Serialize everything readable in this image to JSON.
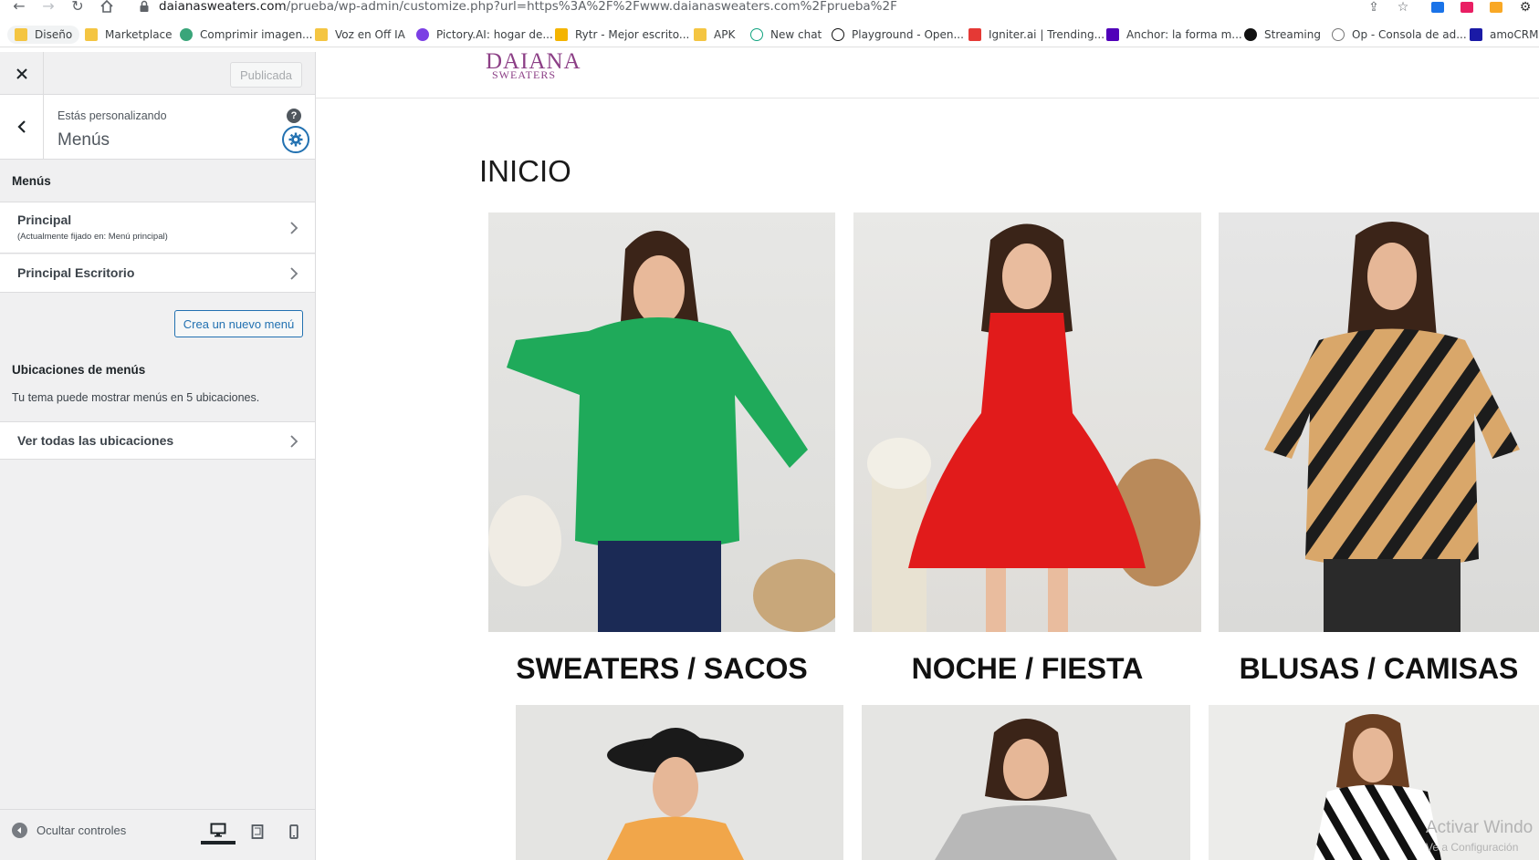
{
  "browser": {
    "url_host": "daianasweaters.com",
    "url_path": "/prueba/wp-admin/customize.php?url=https%3A%2F%2Fwww.daianasweaters.com%2Fprueba%2F",
    "bookmarks": [
      "Diseño",
      "Marketplace",
      "Comprimir imagen...",
      "Voz en Off IA",
      "Pictory.AI: hogar de...",
      "Rytr - Mejor escrito...",
      "APK",
      "New chat",
      "Playground - Open...",
      "Igniter.ai | Trending...",
      "Anchor: la forma m...",
      "Streaming",
      "Op - Consola de ad...",
      "amoCRM:"
    ]
  },
  "customizer": {
    "publish_label": "Publicada",
    "customizing_label": "Estás personalizando",
    "section_title": "Menús",
    "menus_heading": "Menús",
    "menus": [
      {
        "label": "Principal",
        "sub": "(Actualmente fijado en: Menú principal)"
      },
      {
        "label": "Principal Escritorio",
        "sub": ""
      }
    ],
    "new_menu_label": "Crea un nuevo menú",
    "locations_heading": "Ubicaciones de menús",
    "locations_desc": "Tu tema puede mostrar menús en 5 ubicaciones.",
    "all_locations_label": "Ver todas las ubicaciones",
    "hide_controls_label": "Ocultar controles"
  },
  "site": {
    "logo_main": "DAIANA",
    "logo_sub": "SWEATERS",
    "page_title": "INICIO",
    "categories": [
      "SWEATERS / SACOS",
      "NOCHE / FIESTA",
      "BLUSAS / CAMISAS"
    ]
  },
  "os": {
    "watermark": "Activar Windo",
    "watermark_sub": "Ve a Configuración"
  }
}
